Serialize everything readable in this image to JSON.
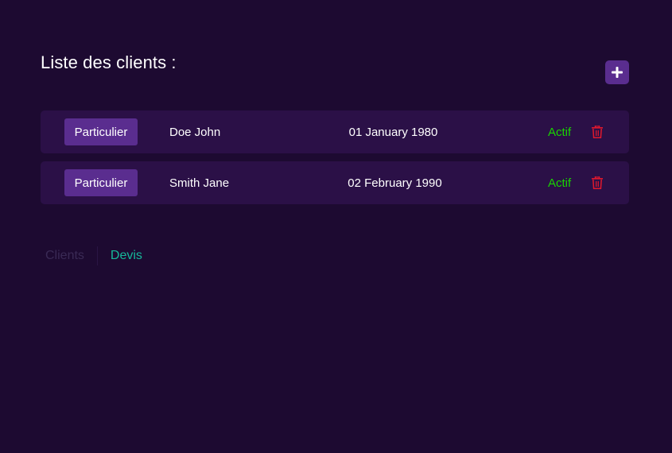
{
  "header": {
    "title": "Liste des clients :"
  },
  "add_button": {
    "icon": "plus-icon",
    "color": "#5a2d8f"
  },
  "clients": [
    {
      "type": "Particulier",
      "name": "Doe John",
      "birth_date": "01 January 1980",
      "status": "Actif"
    },
    {
      "type": "Particulier",
      "name": "Smith Jane",
      "birth_date": "02 February 1990",
      "status": "Actif"
    }
  ],
  "nav": {
    "clients_label": "Clients",
    "devis_label": "Devis"
  },
  "colors": {
    "background": "#1d0a31",
    "row_background": "#2b1047",
    "badge": "#5a2d8f",
    "status_active": "#19d400",
    "delete": "#e0182d",
    "nav_active": "#16b89a",
    "nav_inactive": "#3a2a55"
  }
}
